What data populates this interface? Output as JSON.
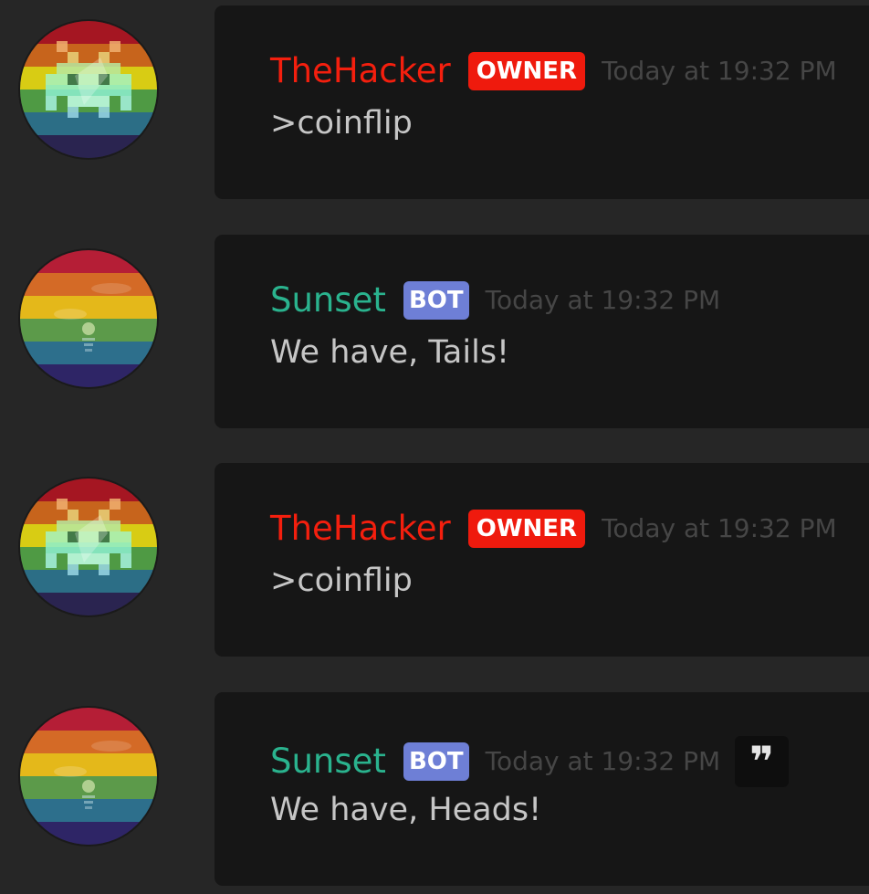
{
  "chat": {
    "messages": [
      {
        "author": "TheHacker",
        "author_color": "#f41f0e",
        "badge": "OWNER",
        "badge_color": "#ef1a0d",
        "avatar": "pixel-invader-rainbow-avatar",
        "timestamp": "Today at 19:32 PM",
        "content": ">coinflip"
      },
      {
        "author": "Sunset",
        "author_color": "#2ab38e",
        "badge": "BOT",
        "badge_color": "#6e7fd6",
        "avatar": "sunset-rainbow-avatar",
        "timestamp": "Today at 19:32 PM",
        "content": "We have, Tails!"
      },
      {
        "author": "TheHacker",
        "author_color": "#f41f0e",
        "badge": "OWNER",
        "badge_color": "#ef1a0d",
        "avatar": "pixel-invader-rainbow-avatar",
        "timestamp": "Today at 19:32 PM",
        "content": ">coinflip"
      },
      {
        "author": "Sunset",
        "author_color": "#2ab38e",
        "badge": "BOT",
        "badge_color": "#6e7fd6",
        "avatar": "sunset-rainbow-avatar",
        "timestamp": "Today at 19:32 PM",
        "content": "We have, Heads!",
        "quote_icon": "quote-icon",
        "quote_glyph": "❞"
      }
    ]
  }
}
